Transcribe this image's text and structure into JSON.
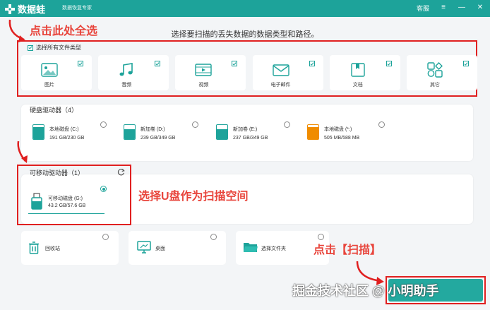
{
  "titlebar": {
    "brand": "数据蛙",
    "subtitle": "数据恢复专家",
    "service": "客服",
    "controls": [
      "≡",
      "—",
      "✕"
    ]
  },
  "annotations": {
    "select_all": "点击此处全选",
    "select_usb": "选择U盘作为扫描空间",
    "click_scan": "点击【扫描】",
    "watermark": "掘金技术社区 @ 小明助手"
  },
  "main_hint": "选择要扫描的丢失数据的数据类型和路径。",
  "file_types": {
    "select_all_label": "选择所有文件类型",
    "items": [
      {
        "label": "图片",
        "icon": "image-icon",
        "checked": true
      },
      {
        "label": "音频",
        "icon": "music-icon",
        "checked": true
      },
      {
        "label": "视频",
        "icon": "video-icon",
        "checked": true
      },
      {
        "label": "电子邮件",
        "icon": "email-icon",
        "checked": true
      },
      {
        "label": "文档",
        "icon": "document-icon",
        "checked": true
      },
      {
        "label": "其它",
        "icon": "other-icon",
        "checked": true
      }
    ]
  },
  "hard_drives": {
    "title": "硬盘驱动器（4）",
    "items": [
      {
        "name": "本地磁盘 (C:)",
        "size": "191 GB/230 GB",
        "used_fraction": 0.83,
        "color": "#1da39a"
      },
      {
        "name": "新加卷 (D:)",
        "size": "239 GB/349 GB",
        "used_fraction": 0.68,
        "color": "#1da39a"
      },
      {
        "name": "新加卷 (E:)",
        "size": "237 GB/349 GB",
        "used_fraction": 0.68,
        "color": "#1da39a"
      },
      {
        "name": "本地磁盘 (*:)",
        "size": "505 MB/588 MB",
        "used_fraction": 0.86,
        "color": "#f08c00"
      }
    ]
  },
  "removable": {
    "title": "可移动驱动器（1）",
    "items": [
      {
        "name": "可移动磁盘 (G:)",
        "size": "43.2 GB/57.6 GB",
        "used_fraction": 0.75,
        "selected": true
      }
    ]
  },
  "locations": [
    {
      "label": "回收站",
      "icon": "trash-icon"
    },
    {
      "label": "桌面",
      "icon": "desktop-icon"
    },
    {
      "label": "选择文件夹",
      "icon": "folder-icon"
    }
  ],
  "colors": {
    "accent": "#1da39a",
    "annotation": "#e8453c",
    "orange": "#f08c00"
  }
}
